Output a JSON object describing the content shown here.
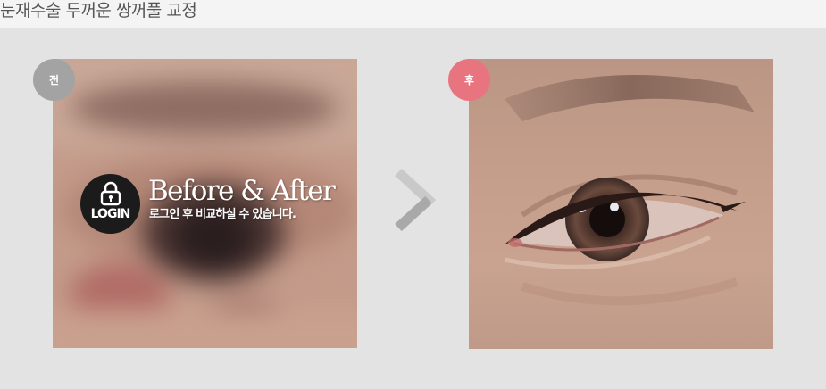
{
  "header": {
    "title": "눈재수술 두꺼운 쌍꺼풀 교정"
  },
  "before_panel": {
    "badge_label": "전",
    "badge_color": "#a3a3a3",
    "locked": true
  },
  "login_overlay": {
    "icon": "lock-icon",
    "login_label": "LOGIN",
    "title": "Before & After",
    "subtitle": "로그인 후 비교하실 수 있습니다."
  },
  "after_panel": {
    "badge_label": "후",
    "badge_color": "#e87480"
  },
  "navigation": {
    "icon": "chevron-right-icon"
  }
}
